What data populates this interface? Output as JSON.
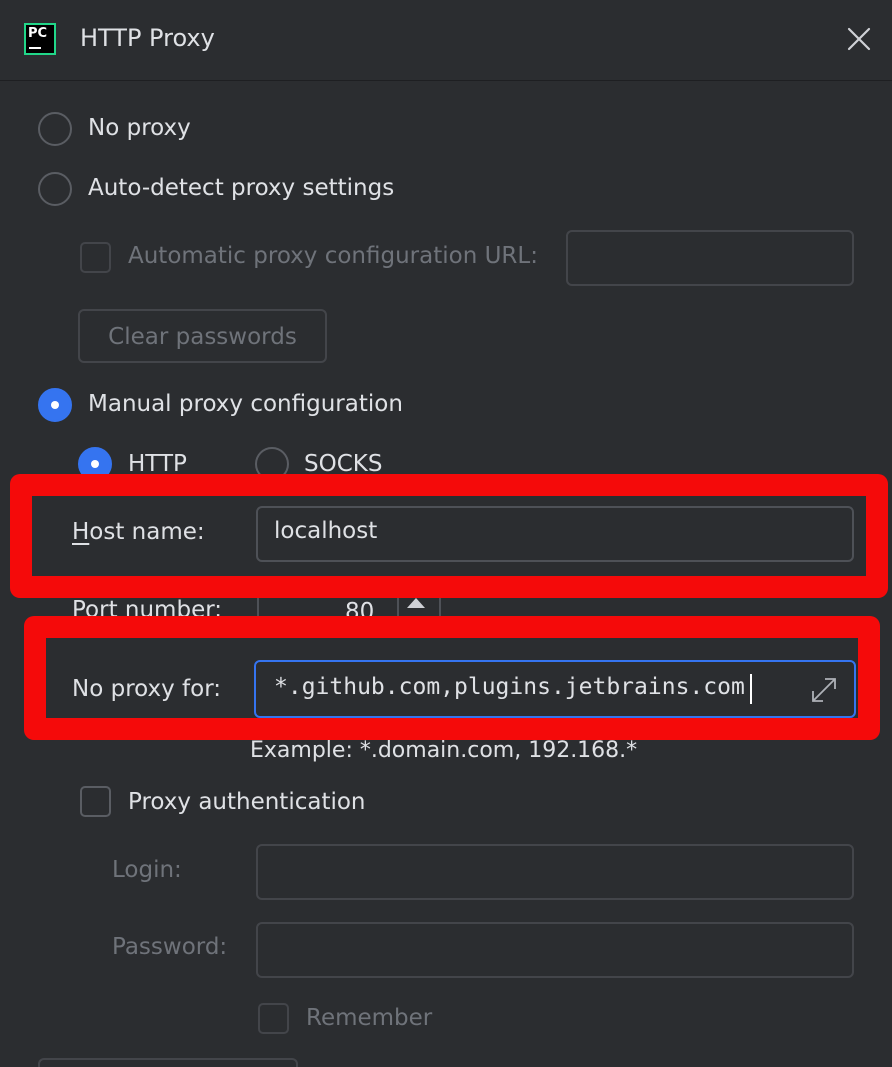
{
  "window": {
    "title": "HTTP Proxy",
    "logo_text": "PC"
  },
  "options": {
    "no_proxy": "No proxy",
    "auto_detect": "Auto-detect proxy settings",
    "auto_config_url": "Automatic proxy configuration URL:",
    "auto_config_url_value": "",
    "clear_passwords": "Clear passwords",
    "manual": "Manual proxy configuration",
    "selected": "manual"
  },
  "manual": {
    "protocols": [
      "HTTP",
      "SOCKS"
    ],
    "selected_protocol": "HTTP",
    "host_label": "Host name:",
    "host_value": "localhost",
    "port_label": "Port number:",
    "port_value": "80",
    "no_proxy_label": "No proxy for:",
    "no_proxy_value": "*.github.com,plugins.jetbrains.com",
    "example": "Example: *.domain.com, 192.168.*"
  },
  "auth": {
    "label": "Proxy authentication",
    "checked": false,
    "login_label": "Login:",
    "login_value": "",
    "password_label": "Password:",
    "password_value": "",
    "remember_label": "Remember"
  },
  "colors": {
    "background": "#2b2d30",
    "accent": "#3574f0",
    "highlight": "#f50a0a",
    "text": "#dfe1e5",
    "disabled_text": "#6f737a"
  },
  "icons": {
    "close": "close-icon",
    "expand": "expand-icon",
    "spinner": "spinner-arrow-icon"
  }
}
